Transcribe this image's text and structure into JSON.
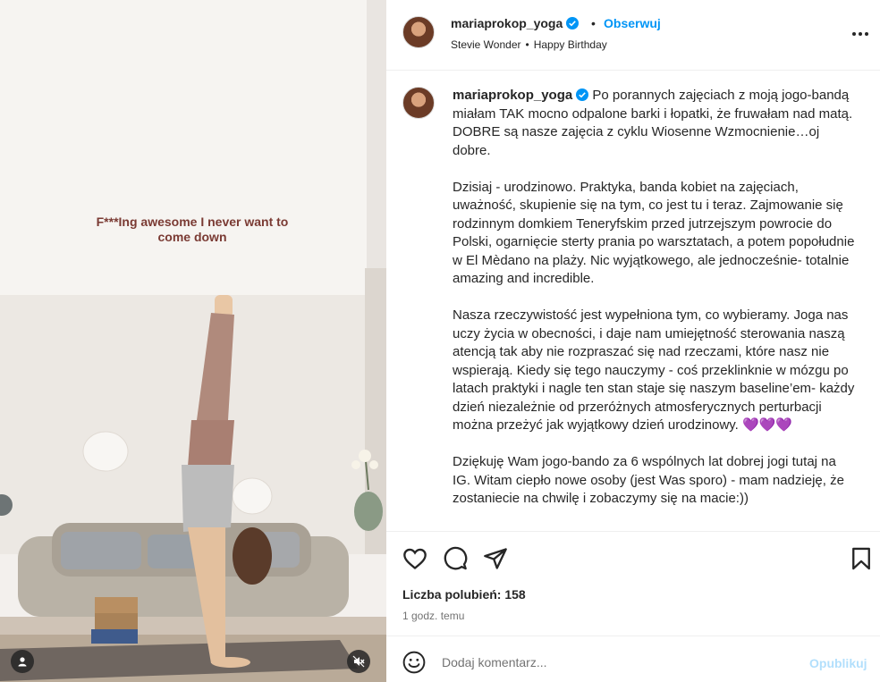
{
  "media": {
    "overlay_text": "F***Ing awesome I never want to come down",
    "user_tag_icon": "user-icon",
    "mute_icon": "speaker-muted-icon"
  },
  "post": {
    "username": "mariaprokop_yoga",
    "dot": "•",
    "follow_label": "Obserwuj",
    "music_artist": "Stevie Wonder",
    "music_sep": "•",
    "music_song": "Happy Birthday",
    "more_icon": "more-options-icon"
  },
  "caption": {
    "username": "mariaprokop_yoga",
    "text": " Po porannych zajęciach z moją jogo-bandą miałam TAK mocno odpalone barki i łopatki, że fruwałam nad matą. DOBRE są nasze zajęcia z cyklu Wiosenne Wzmocnienie…oj dobre.\n\nDzisiaj - urodzinowo. Praktyka, banda kobiet na zajęciach, uważność, skupienie się na tym, co jest tu i teraz. Zajmowanie się rodzinnym domkiem Teneryfskim przed jutrzejszym powrocie do Polski, ogarnięcie sterty prania po warsztatach, a potem popołudnie w El Mèdano na plaży. Nic wyjątkowego, ale jednocześnie- totalnie amazing and incredible.\n\nNasza rzeczywistość jest wypełniona tym, co wybieramy. Joga nas uczy życia w obecności, i daje nam umiejętność sterowania naszą atencją tak aby nie rozpraszać się nad rzeczami, które nasz nie wspierają. Kiedy się tego nauczymy - coś przeklinknie w mózgu po latach praktyki i nagle ten stan staje się naszym baseline’em- każdy dzień niezależnie od przeróżnych atmosferycznych perturbacji można przeżyć jak wyjątkowy dzień urodzinowy. 💜💜💜\n\nDziękuję Wam jogo-bando za 6 wspólnych lat dobrej jogi tutaj na IG. Witam ciepło nowe osoby (jest Was sporo) - mam nadzieję, że zostaniecie na chwilę i zobaczymy się na macie:))"
  },
  "actions": {
    "like_icon": "heart-icon",
    "comment_icon": "comment-icon",
    "share_icon": "share-icon",
    "save_icon": "bookmark-icon"
  },
  "stats": {
    "likes": "Liczba polubień: 158",
    "time": "1 godz. temu"
  },
  "comment": {
    "placeholder": "Dodaj komentarz...",
    "publish_label": "Opublikuj",
    "emoji_icon": "emoji-icon"
  },
  "colors": {
    "accent": "#0095f6",
    "publish_disabled": "#b2dffc",
    "overlay_text": "#7a3a33"
  }
}
